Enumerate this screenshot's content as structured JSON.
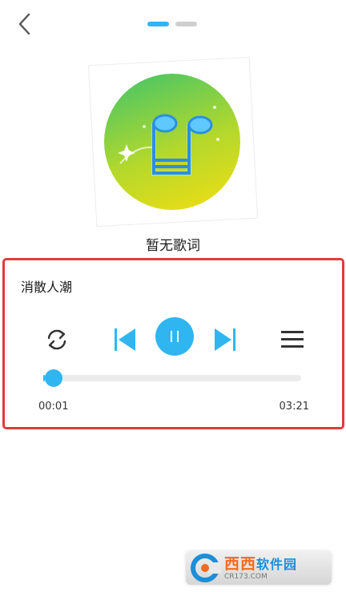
{
  "header": {
    "back_icon": "chevron-left-icon",
    "page_indicator": {
      "count": 2,
      "active_index": 0
    }
  },
  "album": {
    "art_icon": "music-note-icon",
    "lyrics_text": "暂无歌词"
  },
  "player": {
    "song_title": "消散人潮",
    "controls": {
      "repeat_icon": "repeat-icon",
      "prev_icon": "skip-previous-icon",
      "play_pause_icon": "pause-icon",
      "next_icon": "skip-next-icon",
      "playlist_icon": "menu-icon"
    },
    "progress": {
      "fraction": 0.005
    },
    "time_current": "00:01",
    "time_total": "03:21"
  },
  "watermark": {
    "brand": "西西",
    "brand_suffix": "软件园",
    "site": "CR173.COM"
  },
  "colors": {
    "accent": "#2fb6f0",
    "highlight_border": "#e23b3b",
    "indicator_inactive": "#cfcfcf"
  }
}
